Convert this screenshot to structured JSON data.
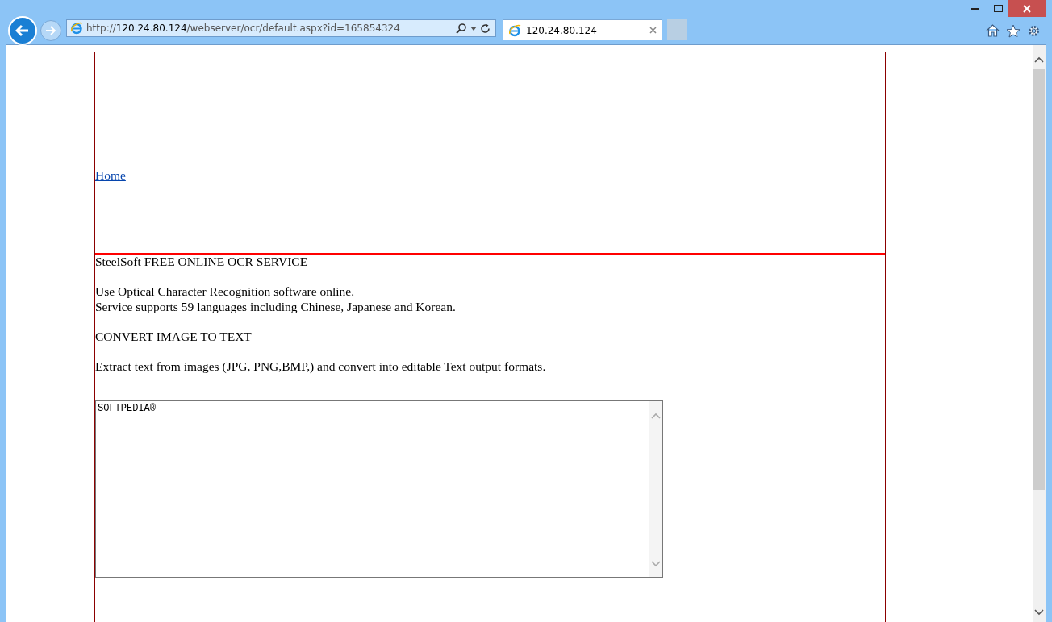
{
  "browser": {
    "address": {
      "prefix": "http://",
      "host": "120.24.80.124",
      "path": "/webserver/ocr/default.aspx?id=165854324"
    },
    "tabs": [
      {
        "title": "120.24.80.124",
        "selected": true
      }
    ]
  },
  "page": {
    "header_link": "Home",
    "title": "SteelSoft FREE ONLINE OCR SERVICE",
    "intro_lines": [
      "Use Optical Character Recognition software online.",
      "Service supports 59 languages including Chinese, Japanese and Korean."
    ],
    "heading": "CONVERT IMAGE TO TEXT",
    "description": "Extract text from images (JPG, PNG,BMP,) and convert into editable Text output formats.",
    "text_area": {
      "value": "SOFTPEDIA®"
    }
  }
}
